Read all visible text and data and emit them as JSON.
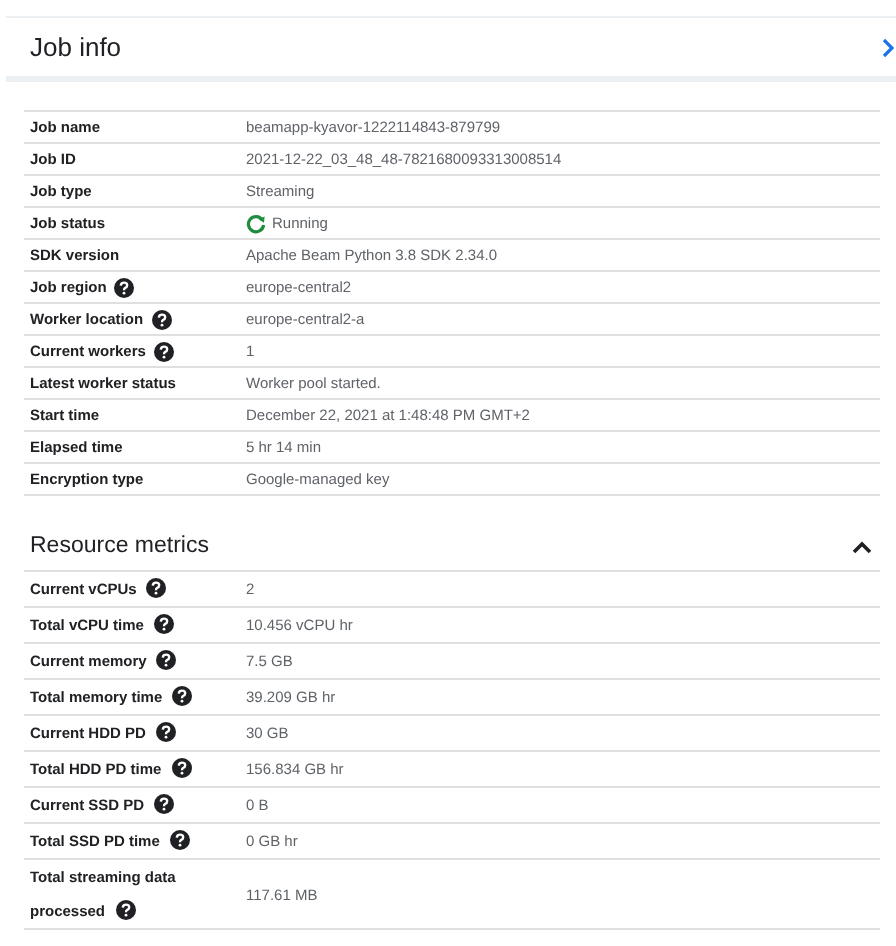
{
  "job_info": {
    "title": "Job info",
    "rows": [
      {
        "label": "Job name",
        "value": "beamapp-kyavor-1222114843-879799",
        "help": false,
        "kind": "text"
      },
      {
        "label": "Job ID",
        "value": "2021-12-22_03_48_48-7821680093313008514",
        "help": false,
        "kind": "text"
      },
      {
        "label": "Job type",
        "value": "Streaming",
        "help": false,
        "kind": "text"
      },
      {
        "label": "Job status",
        "value": "Running",
        "help": false,
        "kind": "status"
      },
      {
        "label": "SDK version",
        "value": "Apache Beam Python 3.8 SDK 2.34.0",
        "help": false,
        "kind": "text"
      },
      {
        "label": "Job region",
        "value": "europe-central2",
        "help": true,
        "kind": "text"
      },
      {
        "label": "Worker location",
        "value": "europe-central2-a",
        "help": true,
        "kind": "text"
      },
      {
        "label": "Current workers",
        "value": "1",
        "help": true,
        "kind": "text"
      },
      {
        "label": "Latest worker status",
        "value": "Worker pool started.",
        "help": false,
        "kind": "text"
      },
      {
        "label": "Start time",
        "value": "December 22, 2021 at 1:48:48 PM GMT+2",
        "help": false,
        "kind": "text"
      },
      {
        "label": "Elapsed time",
        "value": "5 hr 14 min",
        "help": false,
        "kind": "text"
      },
      {
        "label": "Encryption type",
        "value": "Google-managed key",
        "help": false,
        "kind": "text"
      }
    ]
  },
  "resource_metrics": {
    "title": "Resource metrics",
    "expanded": true,
    "rows": [
      {
        "label": "Current vCPUs",
        "value": "2",
        "help": true
      },
      {
        "label": "Total vCPU time",
        "value": "10.456 vCPU hr",
        "help": true
      },
      {
        "label": "Current memory",
        "value": "7.5 GB",
        "help": true
      },
      {
        "label": "Total memory time",
        "value": "39.209 GB hr",
        "help": true
      },
      {
        "label": "Current HDD PD",
        "value": "30 GB",
        "help": true
      },
      {
        "label": "Total HDD PD time",
        "value": "156.834 GB hr",
        "help": true
      },
      {
        "label": "Current SSD PD",
        "value": "0 B",
        "help": true
      },
      {
        "label": "Total SSD PD time",
        "value": "0 GB hr",
        "help": true
      },
      {
        "label": "Total streaming data processed",
        "value": "117.61 MB",
        "help": true
      }
    ]
  }
}
